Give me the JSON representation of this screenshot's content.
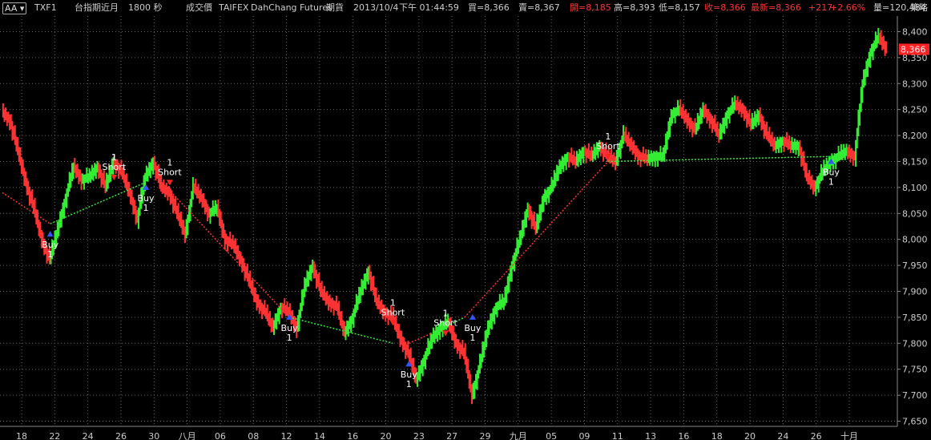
{
  "toolbar": {
    "aa_label": "AA",
    "symbol": "TXF1",
    "name": "台指期近月",
    "interval": "1800 秒",
    "field": "成交價",
    "exchange": "TAIFEX",
    "source": "DahChang Futures",
    "type": "期貨",
    "date": "2013/10/4",
    "time": "下午 01:44:59",
    "bid": "買=8,366",
    "ask": "賣=8,367",
    "open": "開=8,185",
    "high": "高=8,393",
    "low": "低=8,157",
    "close": "收=8,366",
    "last": "最新=8,366",
    "change": "+217",
    "change_pct": "+2.66%",
    "volume": "量=120,484",
    "strategy": "策略",
    "colors": {
      "up": "#ff3333",
      "label": "#cccccc",
      "text": "#ffffff"
    }
  },
  "chart_data": {
    "type": "line",
    "ylim": [
      7640,
      8430
    ],
    "y_ticks": [
      "8,400",
      "8,350",
      "8,300",
      "8,250",
      "8,200",
      "8,150",
      "8,100",
      "8,050",
      "8,000",
      "7,950",
      "7,900",
      "7,850",
      "7,800",
      "7,750",
      "7,700",
      "7,650"
    ],
    "x_ticks": [
      "18",
      "22",
      "24",
      "26",
      "30",
      "八月",
      "06",
      "08",
      "12",
      "14",
      "16",
      "20",
      "23",
      "27",
      "29",
      "九月",
      "05",
      "09",
      "11",
      "13",
      "16",
      "18",
      "20",
      "24",
      "26",
      "十月"
    ],
    "last_price_label": "8,366",
    "last_price": 8366,
    "colors": {
      "up_bar": "#33ee33",
      "down_bar": "#ff3333",
      "grid": "#666666",
      "buy": "#3355ff",
      "short": "#ff2222",
      "trend_up": "#33ee33",
      "trend_down": "#ff3333"
    },
    "price_path": [
      [
        0,
        8245
      ],
      [
        0.5,
        8230
      ],
      [
        1,
        8170
      ],
      [
        1.5,
        8110
      ],
      [
        2,
        8060
      ],
      [
        2.5,
        8000
      ],
      [
        3,
        7960
      ],
      [
        3.5,
        8020
      ],
      [
        4,
        8080
      ],
      [
        4.5,
        8140
      ],
      [
        5,
        8115
      ],
      [
        5.5,
        8120
      ],
      [
        6,
        8140
      ],
      [
        6.5,
        8100
      ],
      [
        7,
        8150
      ],
      [
        7.5,
        8130
      ],
      [
        8,
        8090
      ],
      [
        8.5,
        8040
      ],
      [
        9,
        8120
      ],
      [
        9.5,
        8150
      ],
      [
        10,
        8100
      ],
      [
        10.5,
        8090
      ],
      [
        11,
        8050
      ],
      [
        11.5,
        8010
      ],
      [
        12,
        8100
      ],
      [
        12.5,
        8080
      ],
      [
        13,
        8050
      ],
      [
        13.5,
        8060
      ],
      [
        14,
        8000
      ],
      [
        14.5,
        7990
      ],
      [
        15,
        7960
      ],
      [
        15.5,
        7920
      ],
      [
        16,
        7880
      ],
      [
        16.5,
        7860
      ],
      [
        17,
        7830
      ],
      [
        17.5,
        7870
      ],
      [
        18,
        7860
      ],
      [
        18.5,
        7830
      ],
      [
        19,
        7910
      ],
      [
        19.5,
        7950
      ],
      [
        20,
        7900
      ],
      [
        20.5,
        7880
      ],
      [
        21,
        7870
      ],
      [
        21.5,
        7820
      ],
      [
        22,
        7850
      ],
      [
        22.5,
        7900
      ],
      [
        23,
        7940
      ],
      [
        23.5,
        7880
      ],
      [
        24,
        7860
      ],
      [
        24.5,
        7850
      ],
      [
        25,
        7810
      ],
      [
        25.5,
        7780
      ],
      [
        26,
        7730
      ],
      [
        26.5,
        7770
      ],
      [
        27,
        7810
      ],
      [
        27.5,
        7830
      ],
      [
        28,
        7840
      ],
      [
        28.5,
        7800
      ],
      [
        29,
        7780
      ],
      [
        29.5,
        7700
      ],
      [
        30,
        7760
      ],
      [
        30.5,
        7830
      ],
      [
        31,
        7870
      ],
      [
        31.5,
        7880
      ],
      [
        32,
        7950
      ],
      [
        32.5,
        8000
      ],
      [
        33,
        8060
      ],
      [
        33.5,
        8020
      ],
      [
        34,
        8080
      ],
      [
        34.5,
        8100
      ],
      [
        35,
        8140
      ],
      [
        35.5,
        8160
      ],
      [
        36,
        8150
      ],
      [
        36.5,
        8170
      ],
      [
        37,
        8160
      ],
      [
        37.5,
        8180
      ],
      [
        38,
        8160
      ],
      [
        38.5,
        8150
      ],
      [
        39,
        8200
      ],
      [
        39.5,
        8180
      ],
      [
        40,
        8160
      ],
      [
        40.5,
        8155
      ],
      [
        41,
        8160
      ],
      [
        41.5,
        8160
      ],
      [
        42,
        8240
      ],
      [
        42.5,
        8250
      ],
      [
        43,
        8230
      ],
      [
        43.5,
        8210
      ],
      [
        44,
        8250
      ],
      [
        44.5,
        8230
      ],
      [
        45,
        8200
      ],
      [
        45.5,
        8240
      ],
      [
        46,
        8260
      ],
      [
        46.5,
        8250
      ],
      [
        47,
        8220
      ],
      [
        47.5,
        8240
      ],
      [
        48,
        8200
      ],
      [
        48.5,
        8180
      ],
      [
        49,
        8190
      ],
      [
        49.5,
        8180
      ],
      [
        50,
        8180
      ],
      [
        50.5,
        8120
      ],
      [
        51,
        8100
      ],
      [
        51.5,
        8130
      ],
      [
        52,
        8150
      ],
      [
        52.5,
        8160
      ],
      [
        53,
        8170
      ],
      [
        53.5,
        8160
      ],
      [
        54,
        8300
      ],
      [
        54.5,
        8360
      ],
      [
        55,
        8390
      ],
      [
        55.5,
        8366
      ]
    ],
    "trend_segments": [
      {
        "dir": "down",
        "from": [
          0,
          8090
        ],
        "to": [
          3,
          8030
        ]
      },
      {
        "dir": "up",
        "from": [
          3,
          8030
        ],
        "to": [
          9,
          8110
        ]
      },
      {
        "dir": "down",
        "from": [
          10,
          8110
        ],
        "to": [
          18,
          7850
        ]
      },
      {
        "dir": "up",
        "from": [
          18,
          7850
        ],
        "to": [
          24.5,
          7800
        ]
      },
      {
        "dir": "down",
        "from": [
          25.5,
          7800
        ],
        "to": [
          27,
          7820
        ]
      },
      {
        "dir": "up",
        "from": [
          27,
          7820
        ],
        "to": [
          29,
          7850
        ]
      },
      {
        "dir": "down",
        "from": [
          29,
          7850
        ],
        "to": [
          38,
          8150
        ]
      },
      {
        "dir": "up",
        "from": [
          38,
          8150
        ],
        "to": [
          52.5,
          8160
        ]
      }
    ],
    "markers": [
      {
        "kind": "buy",
        "x": 3,
        "price": 8010,
        "label": "Buy",
        "qty": "1"
      },
      {
        "kind": "short",
        "x": 7,
        "price": 8120,
        "label": "Short",
        "qty": "1"
      },
      {
        "kind": "buy",
        "x": 9,
        "price": 8100,
        "label": "Buy",
        "qty": "1"
      },
      {
        "kind": "short",
        "x": 10.5,
        "price": 8110,
        "label": "Short",
        "qty": "1"
      },
      {
        "kind": "buy",
        "x": 18,
        "price": 7850,
        "label": "Buy",
        "qty": "1"
      },
      {
        "kind": "short",
        "x": 24.5,
        "price": 7840,
        "label": "Short",
        "qty": "1"
      },
      {
        "kind": "buy",
        "x": 25.5,
        "price": 7760,
        "label": "Buy",
        "qty": "1"
      },
      {
        "kind": "short",
        "x": 27.8,
        "price": 7820,
        "label": "Short",
        "qty": "1"
      },
      {
        "kind": "buy",
        "x": 29.5,
        "price": 7850,
        "label": "Buy",
        "qty": "1"
      },
      {
        "kind": "short",
        "x": 38,
        "price": 8160,
        "label": "Short",
        "qty": "1"
      },
      {
        "kind": "buy",
        "x": 52,
        "price": 8150,
        "label": "Buy",
        "qty": "1"
      }
    ]
  }
}
